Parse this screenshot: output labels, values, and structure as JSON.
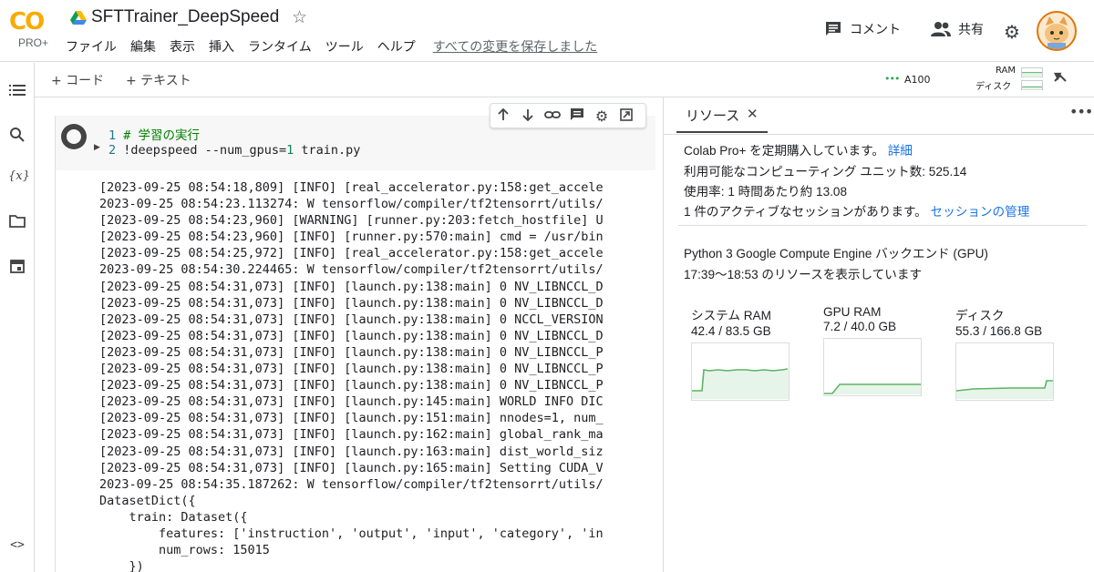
{
  "app": {
    "logo_text": "CO",
    "logo_badge": "PRO+",
    "title": "SFTTrainer_DeepSpeed"
  },
  "menu": {
    "items": [
      "ファイル",
      "編集",
      "表示",
      "挿入",
      "ランタイム",
      "ツール",
      "ヘルプ"
    ],
    "saved_status": "すべての変更を保存しました"
  },
  "header_actions": {
    "comment": "コメント",
    "share": "共有"
  },
  "toolbar": {
    "add_code": "+ コード",
    "add_text": "+ テキスト",
    "accelerator": "A100",
    "ram_label": "RAM",
    "disk_label": "ディスク"
  },
  "cell": {
    "code_lines": [
      {
        "number": "1",
        "text": "# 学習の実行"
      },
      {
        "number": "2",
        "text": "!deepspeed --num_gpus=1 train.py"
      }
    ],
    "output_lines": [
      "[2023-09-25 08:54:18,809] [INFO] [real_accelerator.py:158:get_accele",
      "2023-09-25 08:54:23.113274: W tensorflow/compiler/tf2tensorrt/utils/",
      "[2023-09-25 08:54:23,960] [WARNING] [runner.py:203:fetch_hostfile] U",
      "[2023-09-25 08:54:23,960] [INFO] [runner.py:570:main] cmd = /usr/bin",
      "[2023-09-25 08:54:25,972] [INFO] [real_accelerator.py:158:get_accele",
      "2023-09-25 08:54:30.224465: W tensorflow/compiler/tf2tensorrt/utils/",
      "[2023-09-25 08:54:31,073] [INFO] [launch.py:138:main] 0 NV_LIBNCCL_D",
      "[2023-09-25 08:54:31,073] [INFO] [launch.py:138:main] 0 NV_LIBNCCL_D",
      "[2023-09-25 08:54:31,073] [INFO] [launch.py:138:main] 0 NCCL_VERSION",
      "[2023-09-25 08:54:31,073] [INFO] [launch.py:138:main] 0 NV_LIBNCCL_D",
      "[2023-09-25 08:54:31,073] [INFO] [launch.py:138:main] 0 NV_LIBNCCL_P",
      "[2023-09-25 08:54:31,073] [INFO] [launch.py:138:main] 0 NV_LIBNCCL_P",
      "[2023-09-25 08:54:31,073] [INFO] [launch.py:138:main] 0 NV_LIBNCCL_P",
      "[2023-09-25 08:54:31,073] [INFO] [launch.py:145:main] WORLD INFO DIC",
      "[2023-09-25 08:54:31,073] [INFO] [launch.py:151:main] nnodes=1, num_",
      "[2023-09-25 08:54:31,073] [INFO] [launch.py:162:main] global_rank_ma",
      "[2023-09-25 08:54:31,073] [INFO] [launch.py:163:main] dist_world_siz",
      "[2023-09-25 08:54:31,073] [INFO] [launch.py:165:main] Setting CUDA_V",
      "2023-09-25 08:54:35.187262: W tensorflow/compiler/tf2tensorrt/utils/",
      "DatasetDict({",
      "    train: Dataset({",
      "        features: ['instruction', 'output', 'input', 'category', 'in",
      "        num_rows: 15015",
      "    })",
      "})"
    ]
  },
  "panel": {
    "tab_label": "リソース",
    "subscription_text": "Colab Pro+ を定期購入しています。",
    "subscription_link": "詳細",
    "units_text": "利用可能なコンピューティング ユニット数: 525.14",
    "usage_rate_text": "使用率: 1 時間あたり約 13.08",
    "sessions_text": "1 件のアクティブなセッションがあります。",
    "sessions_link": "セッションの管理",
    "backend_text": "Python 3 Google Compute Engine バックエンド (GPU)",
    "time_range_text": "17:39〜18:53 のリソースを表示しています",
    "gauges": [
      {
        "title": "システム RAM",
        "value": "42.4 / 83.5 GB",
        "used": 42.4,
        "total": 83.5
      },
      {
        "title": "GPU RAM",
        "value": "7.2 / 40.0 GB",
        "used": 7.2,
        "total": 40.0
      },
      {
        "title": "ディスク",
        "value": "55.3 / 166.8 GB",
        "used": 55.3,
        "total": 166.8
      }
    ]
  },
  "colors": {
    "accent": "#1a73e8",
    "logo_orange": "#f9ab00",
    "chart_line": "#5bb563",
    "chart_fill": "#e6f4ea",
    "comment_green": "#008000",
    "number_green": "#098658"
  }
}
